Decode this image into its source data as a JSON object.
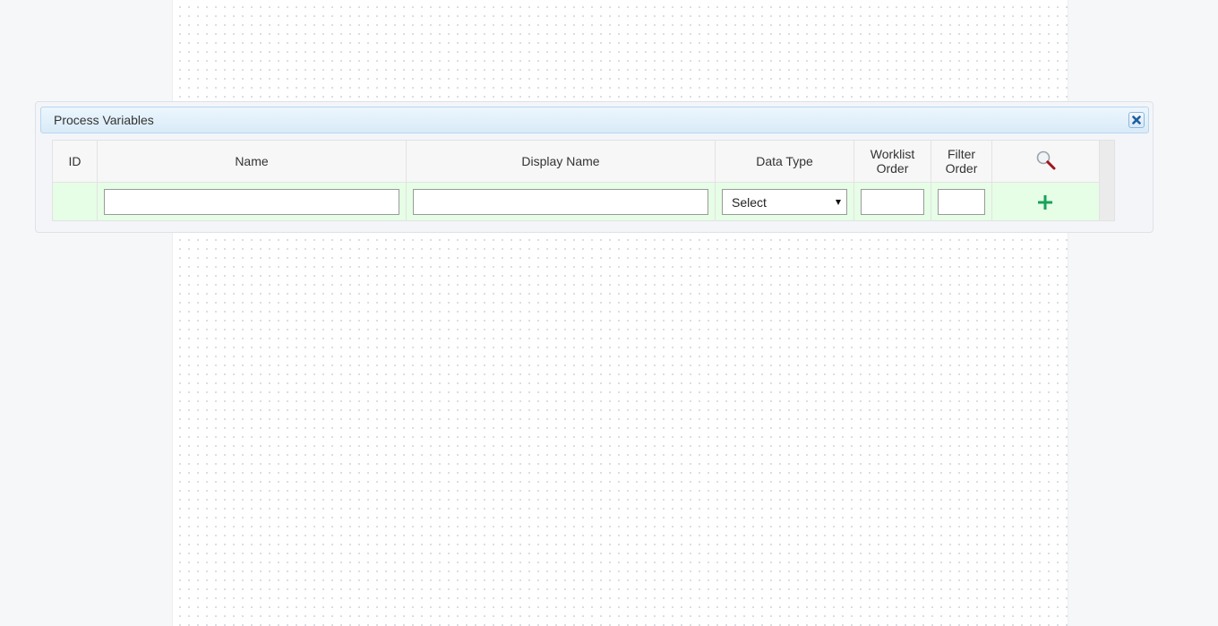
{
  "dialog": {
    "title": "Process Variables"
  },
  "grid": {
    "columns": [
      {
        "key": "id",
        "label": "ID"
      },
      {
        "key": "name",
        "label": "Name"
      },
      {
        "key": "display_name",
        "label": "Display Name"
      },
      {
        "key": "data_type",
        "label": "Data Type"
      },
      {
        "key": "worklist_order",
        "label": "Worklist Order"
      },
      {
        "key": "filter_order",
        "label": "Filter Order"
      }
    ],
    "new_row": {
      "name_value": "",
      "display_name_value": "",
      "data_type_selected": "Select",
      "worklist_order_value": "",
      "filter_order_value": ""
    }
  },
  "icons": {
    "search": "search-icon",
    "add": "plus-icon",
    "close": "close-icon"
  },
  "colors": {
    "new_row_bg": "#e6fde6",
    "add_icon": "#17a35a",
    "search_handle": "#a0141e"
  }
}
